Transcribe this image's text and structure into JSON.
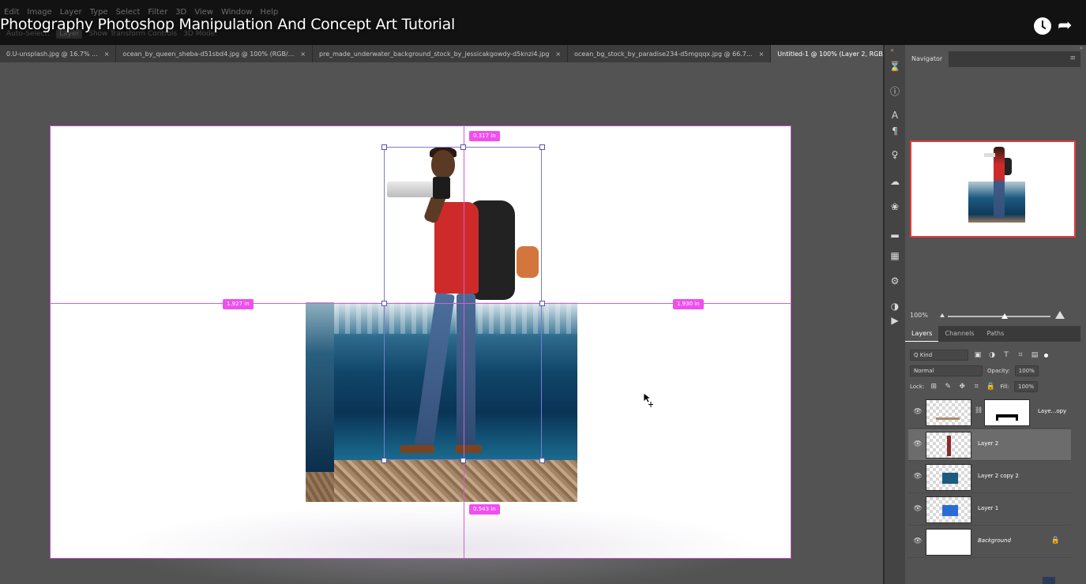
{
  "menu": [
    "Edit",
    "Image",
    "Layer",
    "Type",
    "Select",
    "Filter",
    "3D",
    "View",
    "Window",
    "Help"
  ],
  "options": {
    "auto_select": "Auto-Select:",
    "layer_target": "Layer",
    "show_transform": "Show Transform Controls",
    "mode_3d": "3D Mode:"
  },
  "video_title": "Photography Photoshop Manipulation And Concept Art Tutorial",
  "tabs": [
    {
      "label": "0.U-unsplash.jpg @ 16.7% ...",
      "active": false
    },
    {
      "label": "ocean_by_queen_sheba-d51sbd4.jpg @ 100% (RGB/...",
      "active": false
    },
    {
      "label": "pre_made_underwater_background_stock_by_jessicakgowdy-d5knzi4.jpg",
      "active": false
    },
    {
      "label": "ocean_bg_stock_by_paradise234-d5mgqqx.jpg @ 66.7...",
      "active": false
    },
    {
      "label": "Untitled-1 @ 100% (Layer 2, RGB/8#) *",
      "active": true
    }
  ],
  "tab_close": "×",
  "tab_overflow": "»",
  "measurements": {
    "top": "0.317 in",
    "left": "1.927 in",
    "right": "1.930 in",
    "bottom": "0.543 in"
  },
  "navigator": {
    "title": "Navigator",
    "zoom": "100%"
  },
  "layers": {
    "tabs": [
      "Layers",
      "Channels",
      "Paths"
    ],
    "kind_label": "Q Kind",
    "blend_mode": "Normal",
    "opacity_label": "Opacity:",
    "opacity_value": "100%",
    "lock_label": "Lock:",
    "fill_label": "Fill:",
    "fill_value": "100%",
    "items": [
      {
        "name": "Laye...opy",
        "selected": false,
        "has_mask": true
      },
      {
        "name": "Layer 2",
        "selected": true,
        "has_mask": false
      },
      {
        "name": "Layer 2 copy 2",
        "selected": false,
        "has_mask": false
      },
      {
        "name": "Layer 1",
        "selected": false,
        "has_mask": false
      },
      {
        "name": "Background",
        "selected": false,
        "has_mask": false,
        "locked": true
      }
    ]
  },
  "colors": {
    "guide": "#d35fd3",
    "measure_badge": "#f04ef0",
    "transform_box": "#7b7bd6",
    "navigator_frame": "#e43a3a",
    "app_bg": "#535353"
  },
  "icons": {
    "right_strip": [
      "history-icon",
      "info-icon",
      "character-icon",
      "paragraph-icon",
      "lightbulb-icon",
      "libraries-icon",
      "adjustments-icon",
      "histogram-icon",
      "swatches-icon",
      "properties-icon",
      "color-icon",
      "actions-icon"
    ]
  }
}
